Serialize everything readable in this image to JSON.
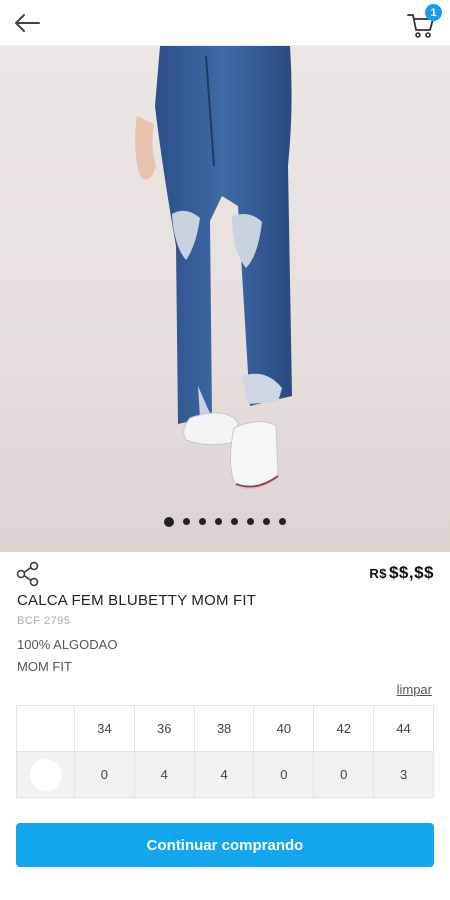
{
  "topbar": {
    "back_icon": "arrow-left-icon",
    "cart_icon": "cart-icon",
    "cart_count": "1",
    "accent": "#1a9ee2"
  },
  "gallery": {
    "image_count": 8,
    "active_index": 0
  },
  "product": {
    "price_currency": "R$",
    "price_value": "$$,$$",
    "name": "CALCA FEM BLUBETTY MOM FIT",
    "code": "BCF 2795",
    "description_1": "100% ALGODAO",
    "description_2": "MOM FIT"
  },
  "sizes": {
    "clear_label": "limpar",
    "headers": [
      "34",
      "36",
      "38",
      "40",
      "42",
      "44"
    ],
    "stock": [
      "0",
      "4",
      "4",
      "0",
      "0",
      "3"
    ]
  },
  "actions": {
    "continue_label": "Continuar comprando",
    "button_color": "#14a6ef"
  }
}
